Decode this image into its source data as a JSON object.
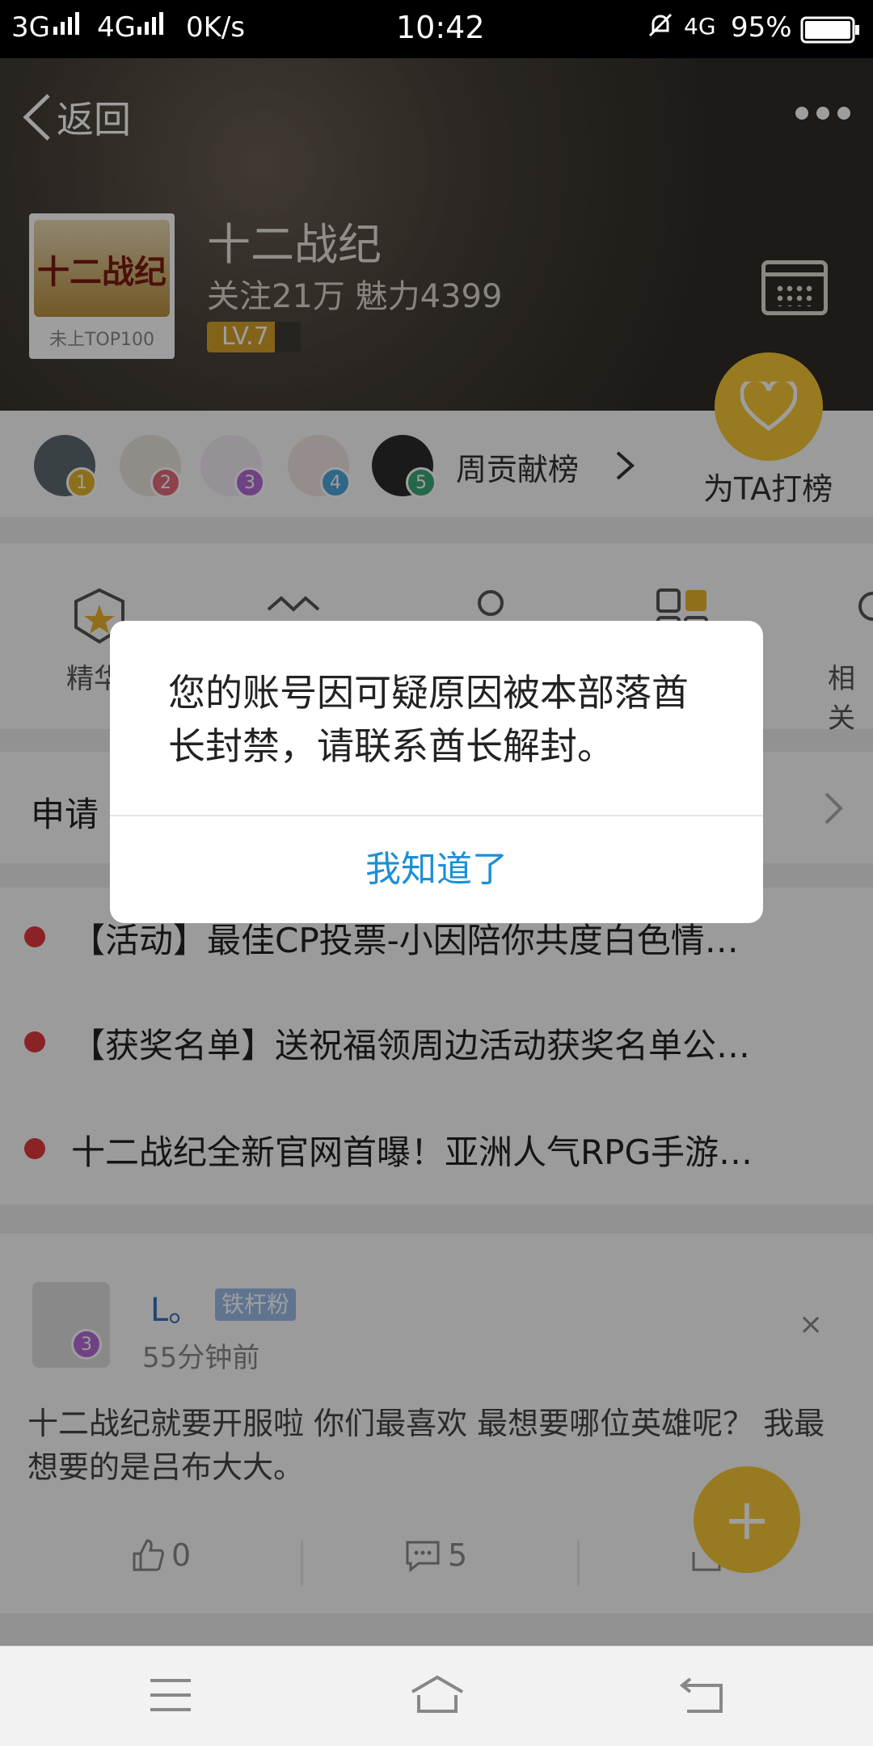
{
  "status_bar": {
    "network": "3G",
    "network2": "4G",
    "speed": "0K/s",
    "time": "10:42",
    "network3": "4G",
    "battery": "95%"
  },
  "header": {
    "back_label": "返回",
    "logo_text": "十二战纪",
    "logo_caption": "未上TOP100",
    "title": "十二战纪",
    "stats": "关注21万  魅力4399",
    "level": "LV.7",
    "level_progress": 0.72
  },
  "contributors": {
    "ranks": [
      "1",
      "2",
      "3",
      "4",
      "5"
    ],
    "rank_colors": [
      "#e3b32a",
      "#e06b7c",
      "#b46bd6",
      "#4ba8d8",
      "#3aa879"
    ],
    "label": "周贡献榜"
  },
  "support": {
    "label": "为TA打榜"
  },
  "features": {
    "first_label": "精华",
    "last_label": "相关"
  },
  "apply": {
    "label": "申请"
  },
  "notices": [
    "【活动】最佳CP投票-小因陪你共度白色情…",
    "【获奖名单】送祝福领周边活动获奖名单公…",
    "十二战纪全新官网首曝！亚洲人气RPG手游…"
  ],
  "post": {
    "user": "L。",
    "badge": "铁杆粉",
    "avatar_rank": "3",
    "time": "55分钟前",
    "close": "×",
    "body": "十二战纪就要开服啦 你们最喜欢 最想要哪位英雄呢？ 我最想要的是吕布大大。",
    "likes": "0",
    "comments": "5"
  },
  "fab_label": "+",
  "dialog": {
    "message": "您的账号因可疑原因被本部落酋长封禁，请联系酋长解封。",
    "button": "我知道了"
  }
}
